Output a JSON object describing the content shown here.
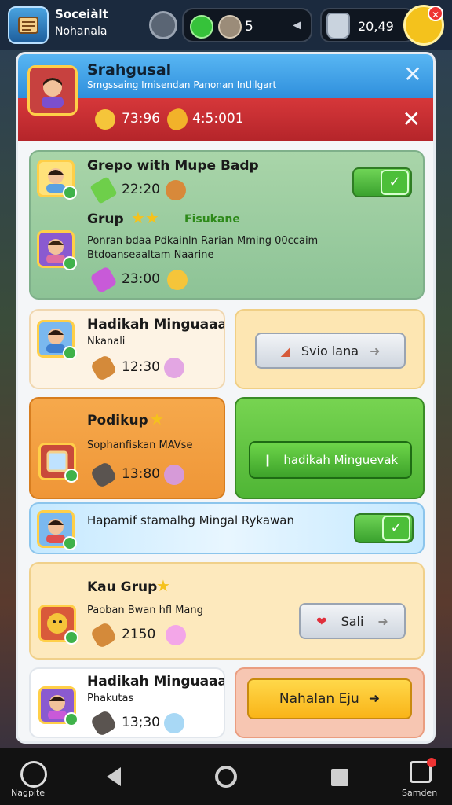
{
  "hud": {
    "title": "Soceiàlt",
    "subtitle": "Nohanala",
    "count": "5",
    "coins": "20,49",
    "profile_badge": "✕"
  },
  "panel_header": {
    "title": "Srahgusal",
    "subtitle": "Smgssaing Imisendan Panonan Intlilgart",
    "value_1": "73:96",
    "value_2": "4:5:001",
    "close_top": "✕",
    "close_red": "✕"
  },
  "group_card": {
    "title": "Grepo with Mupe Badp",
    "value_1": "22:20",
    "group_label": "Grup",
    "stars": "★★",
    "status": "Fisukane",
    "description_line1": "Ponran bdaa Pdkainln Rarian Mming 00ccaim",
    "description_line2": "Btdoanseaaltam Naarine",
    "value_2": "23:00"
  },
  "weekly_card": {
    "title": "Hadikah Minguaaal",
    "subtitle": "Nkanali",
    "value": "12:30",
    "button_label": "Svio lana"
  },
  "podikup_card": {
    "title": "Podikup",
    "subtitle": "Sophanfiskan MAVse",
    "value": "13:80",
    "button_label": "hadikah Minguevak"
  },
  "strip_card": {
    "label": "Hapamif stamalhg Mingal Rykawan"
  },
  "kau_card": {
    "title": "Kau Grup",
    "subtitle": "Paoban Bwan hfl Mang",
    "value": "2150",
    "button_label": "Sali"
  },
  "last_card": {
    "title": "Hadikah Minguaaah",
    "subtitle": "Phakutas",
    "value": "13;30",
    "button_label": "Nahalan Eju"
  },
  "nav": {
    "left_label": "Nagpite",
    "right_label": "Samden"
  },
  "colors": {
    "accent_blue": "#2f8fdc",
    "alert_red": "#c82d30",
    "green": "#4cbf39",
    "orange": "#f39f3a",
    "yellow_button": "#ffc21f"
  }
}
